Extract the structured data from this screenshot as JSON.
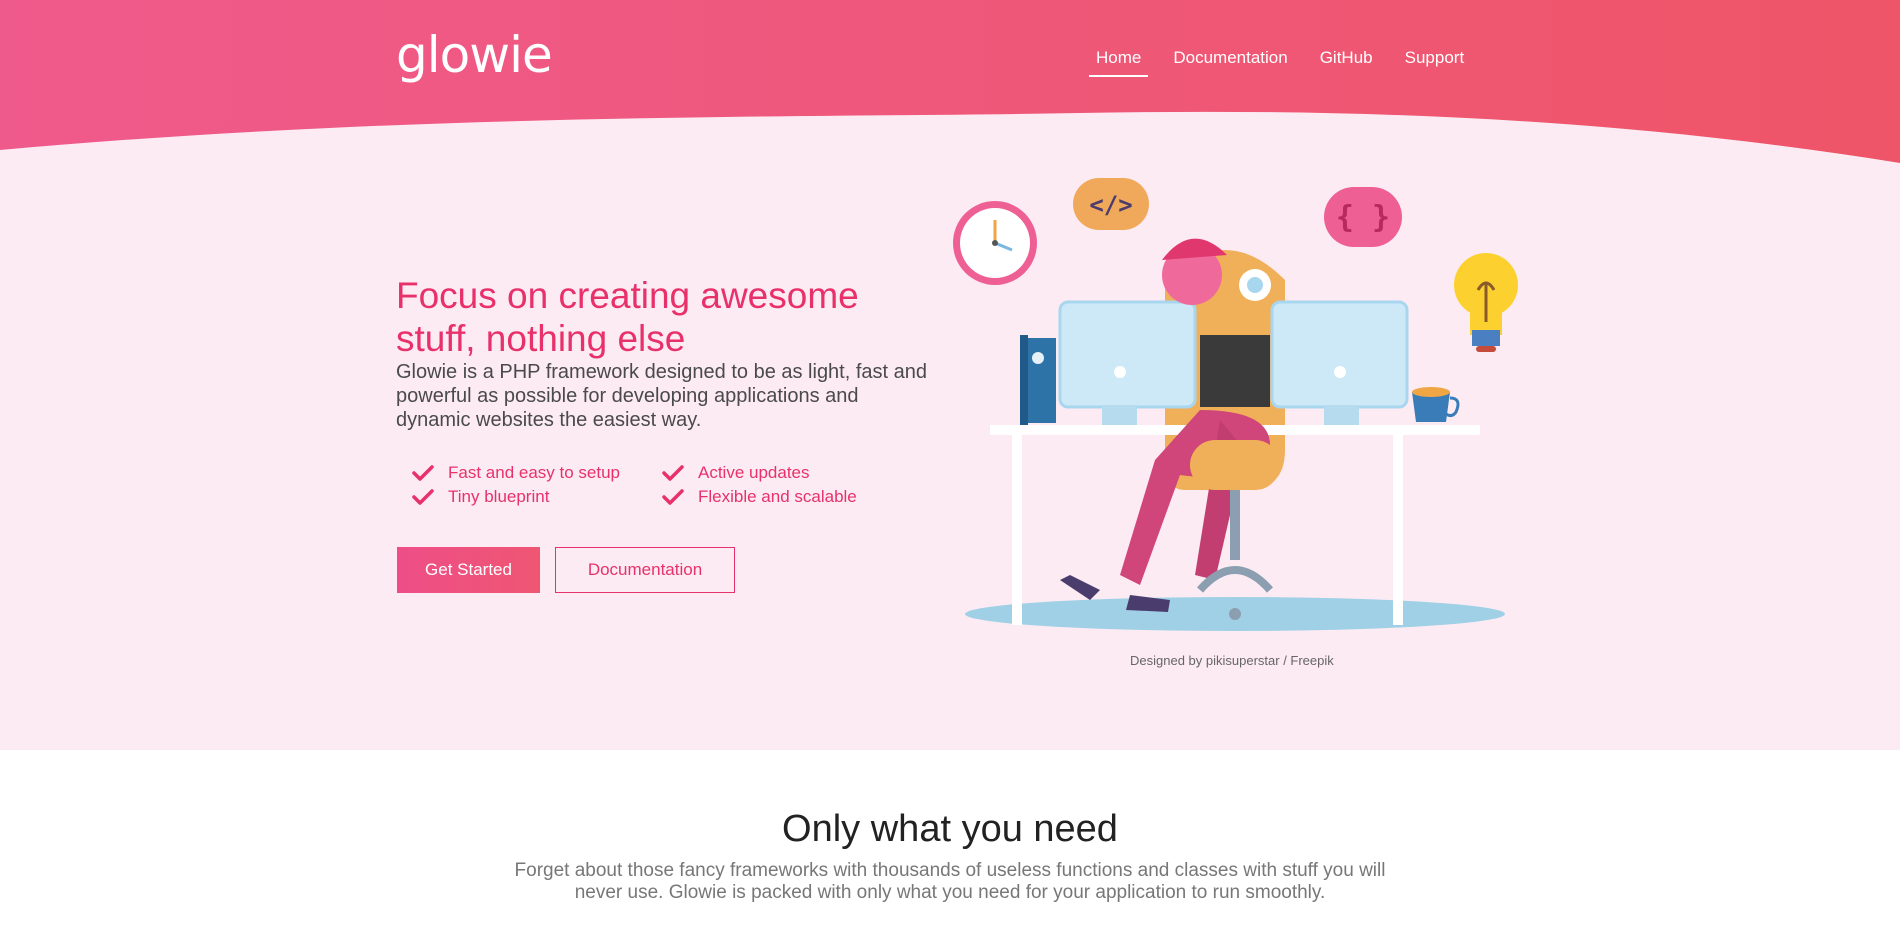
{
  "brand": {
    "logo": "glowie"
  },
  "nav": {
    "items": [
      {
        "label": "Home",
        "active": true
      },
      {
        "label": "Documentation",
        "active": false
      },
      {
        "label": "GitHub",
        "active": false
      },
      {
        "label": "Support",
        "active": false
      }
    ]
  },
  "hero": {
    "title": "Focus on creating awesome stuff, nothing else",
    "description": "Glowie is a PHP framework designed to be as light, fast and powerful as possible for developing applications and dynamic websites the easiest way.",
    "features": [
      "Fast and easy to setup",
      "Active updates",
      "Tiny blueprint",
      "Flexible and scalable"
    ],
    "primary_button": "Get Started",
    "secondary_button": "Documentation",
    "code_badge": "</>",
    "braces_badge": "{ }",
    "credit": "Designed by pikisuperstar / Freepik"
  },
  "section2": {
    "title": "Only what you need",
    "description": "Forget about those fancy frameworks with thousands of useless functions and classes with stuff you will never use. Glowie is packed with only what you need for your application to run smoothly."
  },
  "colors": {
    "accent": "#e8316b",
    "header_start": "#ef5a8c",
    "header_end": "#ef5568",
    "hero_bg": "#fcebf3"
  },
  "icons": [
    "check-icon",
    "clock-icon",
    "code-icon",
    "braces-icon",
    "lightbulb-icon",
    "book-icon",
    "coffee-cup-icon",
    "monitor-icon"
  ]
}
